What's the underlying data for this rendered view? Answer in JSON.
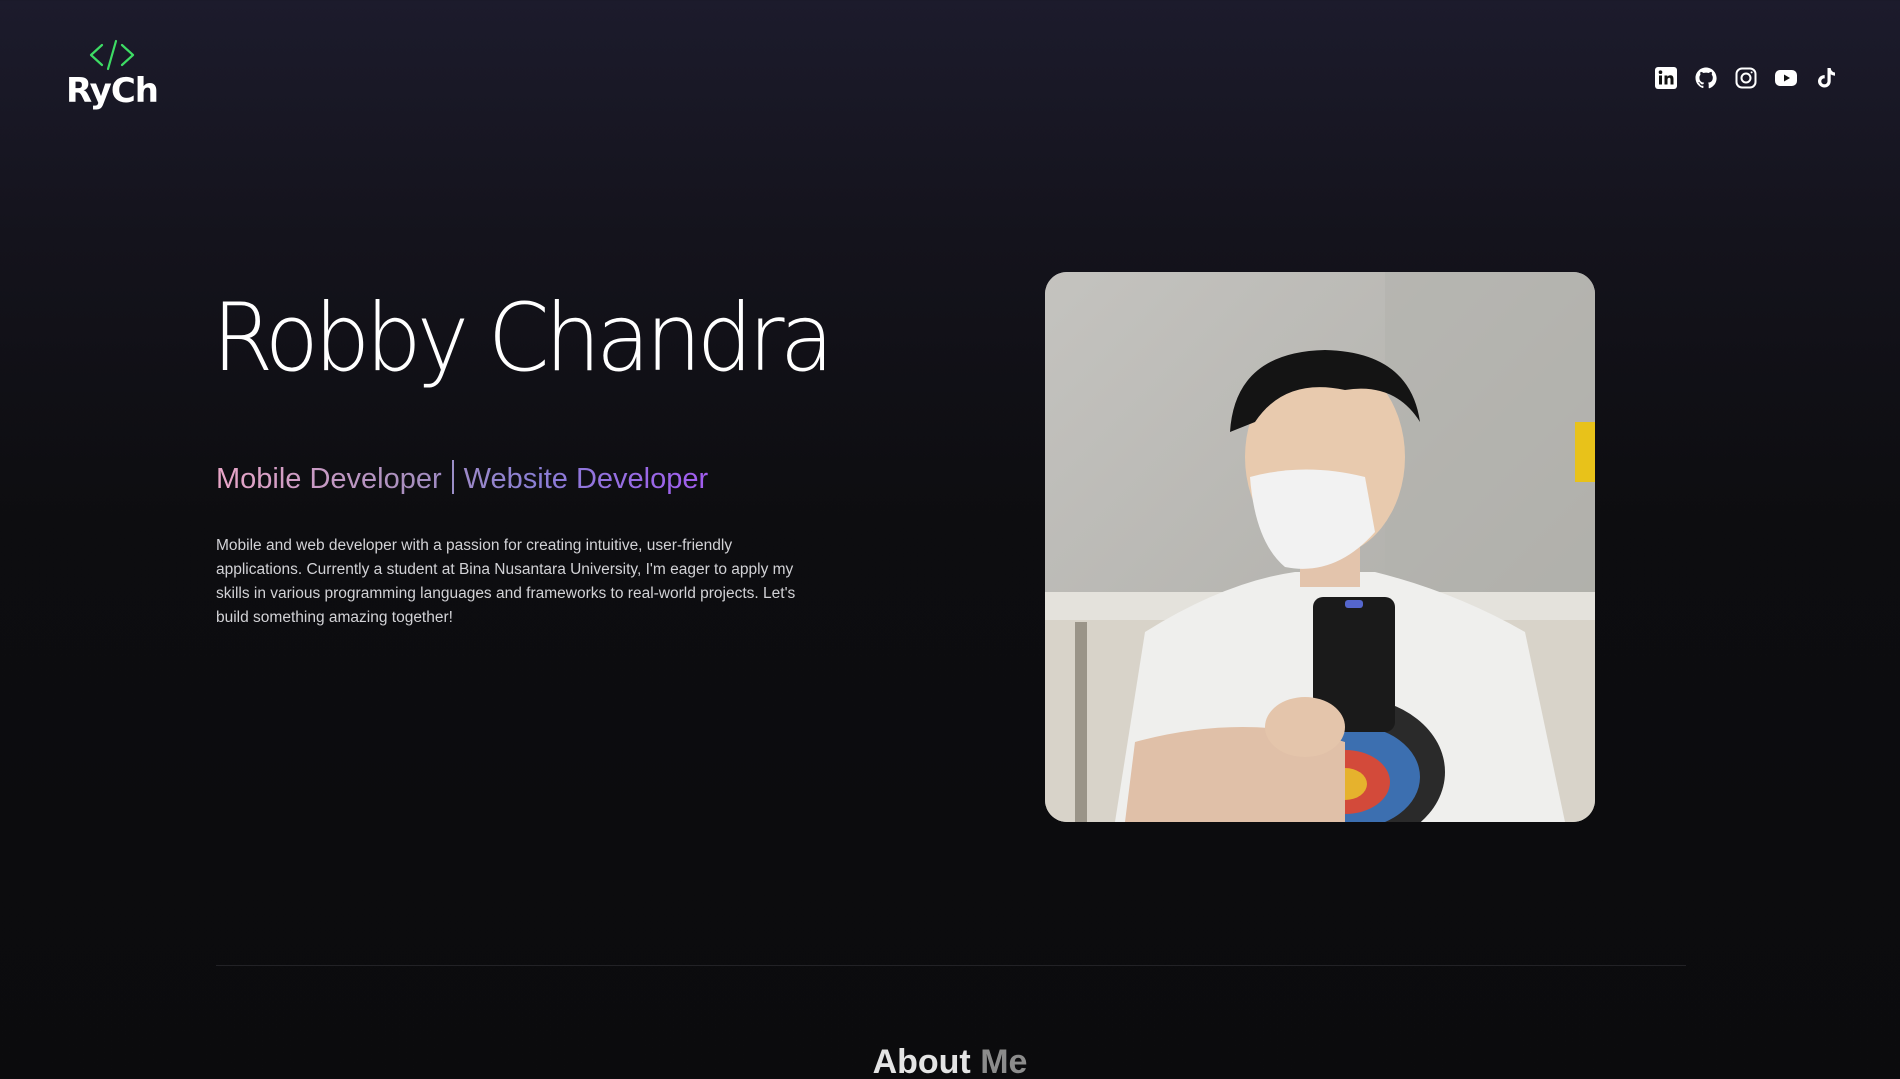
{
  "brand": {
    "logo_text": "RyCh",
    "logo_mark": "code-brackets",
    "accent_color": "#3ddc64"
  },
  "header": {
    "social_links": [
      {
        "name": "linkedin",
        "icon": "linkedin-icon"
      },
      {
        "name": "github",
        "icon": "github-icon"
      },
      {
        "name": "instagram",
        "icon": "instagram-icon"
      },
      {
        "name": "youtube",
        "icon": "youtube-icon"
      },
      {
        "name": "tiktok",
        "icon": "tiktok-icon"
      }
    ]
  },
  "hero": {
    "name": "Robby Chandra",
    "role_1": "Mobile Developer",
    "role_2": "Website Developer",
    "role_gradient": [
      "#e9a6c8",
      "#a88fbf",
      "#8a7fd4",
      "#a25cf0"
    ],
    "bio": "Mobile and web developer with a passion for creating intuitive, user-friendly applications. Currently a student at Bina Nusantara University, I'm eager to apply my skills in various programming languages and frameworks to real-world projects. Let's build something amazing together!"
  },
  "about": {
    "title_part_1": "About",
    "title_part_2": "Me"
  }
}
